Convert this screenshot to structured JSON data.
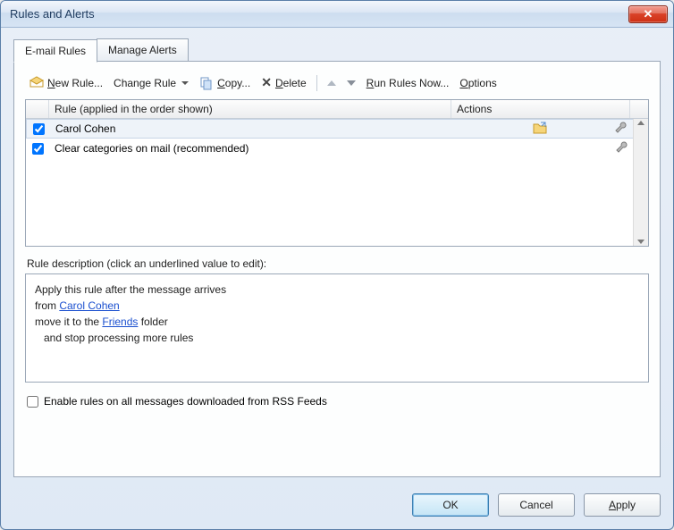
{
  "window": {
    "title": "Rules and Alerts"
  },
  "tabs": {
    "email_rules": "E-mail Rules",
    "manage_alerts": "Manage Alerts"
  },
  "toolbar": {
    "new_rule_pre": "",
    "new_rule_u": "N",
    "new_rule_post": "ew Rule...",
    "change_rule": "Change Rule",
    "copy_u": "C",
    "copy_post": "opy...",
    "delete_u": "D",
    "delete_post": "elete",
    "run_now_pre": "",
    "run_now_u": "R",
    "run_now_post": "un Rules Now...",
    "options_u": "O",
    "options_post": "ptions"
  },
  "list": {
    "header_rule": "Rule (applied in the order shown)",
    "header_actions": "Actions",
    "rows": [
      {
        "checked": true,
        "name": "Carol Cohen",
        "has_move_icon": true
      },
      {
        "checked": true,
        "name": "Clear categories on mail (recommended)",
        "has_move_icon": false
      }
    ]
  },
  "description": {
    "label": "Rule description (click an underlined value to edit):",
    "line1": "Apply this rule after the message arrives",
    "line2_pre": "from ",
    "line2_link": "Carol Cohen",
    "line3_pre": "move it to the ",
    "line3_link": "Friends",
    "line3_post": " folder",
    "line4": "and stop processing more rules"
  },
  "rss_checkbox": {
    "label": "Enable rules on all messages downloaded from RSS Feeds",
    "checked": false
  },
  "buttons": {
    "ok": "OK",
    "cancel": "Cancel",
    "apply_u": "A",
    "apply_post": "pply"
  }
}
